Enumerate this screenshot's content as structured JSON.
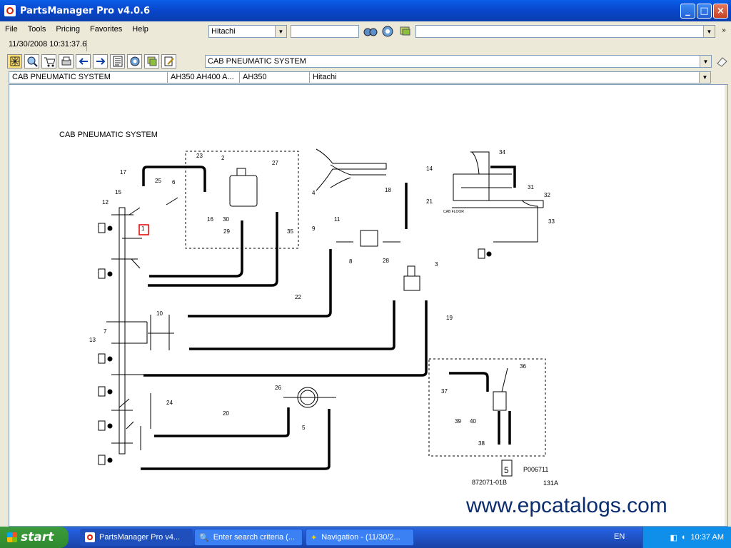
{
  "window": {
    "title": "PartsManager Pro v4.0.6"
  },
  "menu": [
    "File",
    "Tools",
    "Pricing",
    "Favorites",
    "Help"
  ],
  "toolbar": {
    "make_value": "Hitachi",
    "datetime": "11/30/2008 10:31:37.6",
    "section_value": "CAB PNEUMATIC SYSTEM"
  },
  "info": [
    "CAB PNEUMATIC SYSTEM",
    "AH350 AH400 A...",
    "AH350",
    "Hitachi"
  ],
  "diagram": {
    "title": "CAB PNEUMATIC SYSTEM",
    "cab_floor": "CAB FLOOR",
    "ref_code": "P006711",
    "part_number": "872071-01B",
    "page_code": "131A",
    "page_box": "5",
    "watermark": "www.epcatalogs.com",
    "callouts": [
      "1",
      "2",
      "3",
      "4",
      "5",
      "6",
      "7",
      "8",
      "9",
      "10",
      "11",
      "12",
      "13",
      "14",
      "15",
      "16",
      "17",
      "18",
      "19",
      "20",
      "21",
      "22",
      "23",
      "24",
      "25",
      "26",
      "27",
      "28",
      "29",
      "30",
      "31",
      "32",
      "33",
      "34",
      "35",
      "36",
      "37",
      "38",
      "39",
      "40"
    ]
  },
  "taskbar": {
    "start": "start",
    "tasks": [
      "PartsManager Pro v4...",
      "Enter search criteria (...",
      "Navigation - (11/30/2..."
    ],
    "lang": "EN",
    "clock": "10:37 AM"
  }
}
